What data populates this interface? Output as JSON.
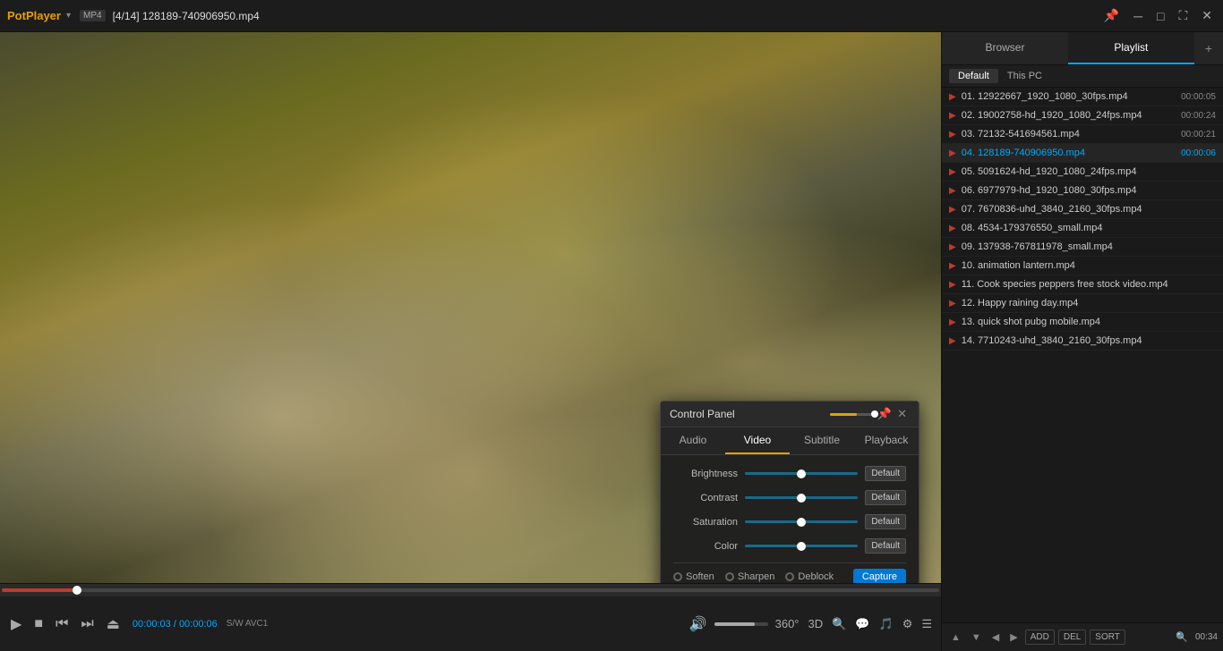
{
  "titlebar": {
    "app_name": "PotPlayer",
    "dropdown_arrow": "▾",
    "format_badge": "MP4",
    "file_info": "[4/14] 128189-740906950.mp4",
    "pin_icon": "📌",
    "minimize_icon": "─",
    "restore_icon": "□",
    "maximize_icon": "⛶",
    "close_icon": "✕"
  },
  "sidebar": {
    "tabs": [
      {
        "label": "Browser",
        "active": false
      },
      {
        "label": "Playlist",
        "active": true
      },
      {
        "label": "+",
        "add": true
      }
    ],
    "playlist_headers": [
      {
        "label": "Default",
        "active": true
      },
      {
        "label": "This PC",
        "active": false
      }
    ],
    "playlist": [
      {
        "num": "01.",
        "name": "12922667_1920_1080_30fps.mp4",
        "duration": "00:00:05",
        "active": false
      },
      {
        "num": "02.",
        "name": "19002758-hd_1920_1080_24fps.mp4",
        "duration": "00:00:24",
        "active": false
      },
      {
        "num": "03.",
        "name": "72132-541694561.mp4",
        "duration": "00:00:21",
        "active": false
      },
      {
        "num": "04.",
        "name": "128189-740906950.mp4",
        "duration": "00:00:06",
        "active": true
      },
      {
        "num": "05.",
        "name": "5091624-hd_1920_1080_24fps.mp4",
        "duration": "",
        "active": false
      },
      {
        "num": "06.",
        "name": "6977979-hd_1920_1080_30fps.mp4",
        "duration": "",
        "active": false
      },
      {
        "num": "07.",
        "name": "7670836-uhd_3840_2160_30fps.mp4",
        "duration": "",
        "active": false
      },
      {
        "num": "08.",
        "name": "4534-179376550_small.mp4",
        "duration": "",
        "active": false
      },
      {
        "num": "09.",
        "name": "137938-767811978_small.mp4",
        "duration": "",
        "active": false
      },
      {
        "num": "10.",
        "name": "animation lantern.mp4",
        "duration": "",
        "active": false
      },
      {
        "num": "11.",
        "name": "Cook species peppers free stock video.mp4",
        "duration": "",
        "active": false
      },
      {
        "num": "12.",
        "name": "Happy raining day.mp4",
        "duration": "",
        "active": false
      },
      {
        "num": "13.",
        "name": "quick shot pubg mobile.mp4",
        "duration": "",
        "active": false
      },
      {
        "num": "14.",
        "name": "7710243-uhd_3840_2160_30fps.mp4",
        "duration": "",
        "active": false
      }
    ],
    "footer_buttons": [
      {
        "label": "▲",
        "title": "move up"
      },
      {
        "label": "▼",
        "title": "move down"
      },
      {
        "label": "◀",
        "title": "left"
      },
      {
        "label": "▶",
        "title": "right"
      }
    ],
    "footer_text_buttons": [
      "ADD",
      "DEL",
      "SORT"
    ],
    "search_placeholder": "",
    "total_time": "00:34"
  },
  "player": {
    "time_current": "00:00:03",
    "time_total": "00:00:06",
    "codec_sw": "S/W",
    "codec_name": "AVC1",
    "seek_percent": 8,
    "volume_percent": 75,
    "btn_360": "360°",
    "btn_3d": "3D",
    "btn_zoom": "🔍"
  },
  "control_panel": {
    "title": "Control Panel",
    "tabs": [
      {
        "label": "Audio",
        "active": false
      },
      {
        "label": "Video",
        "active": true
      },
      {
        "label": "Subtitle",
        "active": false
      },
      {
        "label": "Playback",
        "active": false
      }
    ],
    "sliders": [
      {
        "label": "Brightness",
        "value": 50,
        "default_label": "Default"
      },
      {
        "label": "Contrast",
        "value": 50,
        "default_label": "Default"
      },
      {
        "label": "Saturation",
        "value": 50,
        "default_label": "Default"
      },
      {
        "label": "Color",
        "value": 50,
        "default_label": "Default"
      }
    ],
    "filters": [
      {
        "label": "Soften",
        "selected": false
      },
      {
        "label": "Sharpen",
        "selected": false
      },
      {
        "label": "Deblock",
        "selected": false
      }
    ],
    "capture_label": "Capture",
    "pin_icon": "📌",
    "close_icon": "✕"
  }
}
